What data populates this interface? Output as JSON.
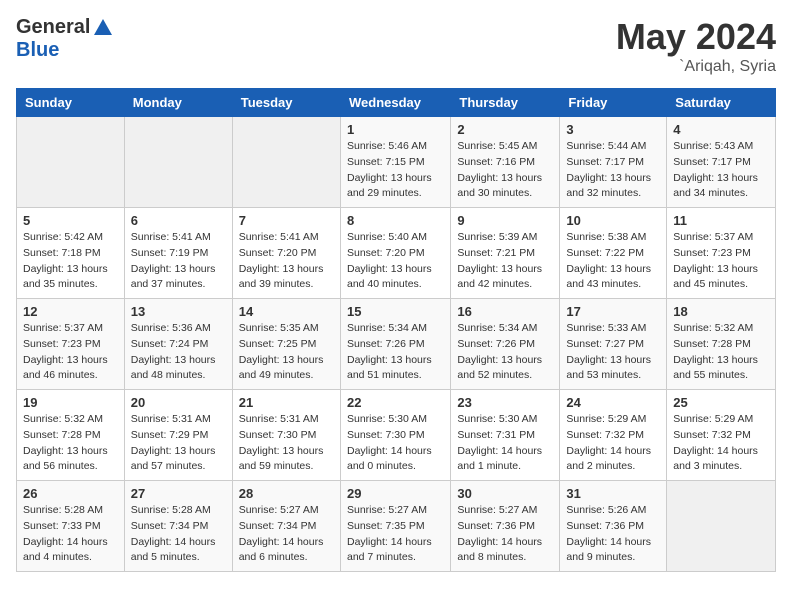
{
  "logo": {
    "general": "General",
    "blue": "Blue"
  },
  "title": "May 2024",
  "location": "`Ariqah, Syria",
  "days_of_week": [
    "Sunday",
    "Monday",
    "Tuesday",
    "Wednesday",
    "Thursday",
    "Friday",
    "Saturday"
  ],
  "weeks": [
    [
      {
        "day": "",
        "info": ""
      },
      {
        "day": "",
        "info": ""
      },
      {
        "day": "",
        "info": ""
      },
      {
        "day": "1",
        "info": "Sunrise: 5:46 AM\nSunset: 7:15 PM\nDaylight: 13 hours\nand 29 minutes."
      },
      {
        "day": "2",
        "info": "Sunrise: 5:45 AM\nSunset: 7:16 PM\nDaylight: 13 hours\nand 30 minutes."
      },
      {
        "day": "3",
        "info": "Sunrise: 5:44 AM\nSunset: 7:17 PM\nDaylight: 13 hours\nand 32 minutes."
      },
      {
        "day": "4",
        "info": "Sunrise: 5:43 AM\nSunset: 7:17 PM\nDaylight: 13 hours\nand 34 minutes."
      }
    ],
    [
      {
        "day": "5",
        "info": "Sunrise: 5:42 AM\nSunset: 7:18 PM\nDaylight: 13 hours\nand 35 minutes."
      },
      {
        "day": "6",
        "info": "Sunrise: 5:41 AM\nSunset: 7:19 PM\nDaylight: 13 hours\nand 37 minutes."
      },
      {
        "day": "7",
        "info": "Sunrise: 5:41 AM\nSunset: 7:20 PM\nDaylight: 13 hours\nand 39 minutes."
      },
      {
        "day": "8",
        "info": "Sunrise: 5:40 AM\nSunset: 7:20 PM\nDaylight: 13 hours\nand 40 minutes."
      },
      {
        "day": "9",
        "info": "Sunrise: 5:39 AM\nSunset: 7:21 PM\nDaylight: 13 hours\nand 42 minutes."
      },
      {
        "day": "10",
        "info": "Sunrise: 5:38 AM\nSunset: 7:22 PM\nDaylight: 13 hours\nand 43 minutes."
      },
      {
        "day": "11",
        "info": "Sunrise: 5:37 AM\nSunset: 7:23 PM\nDaylight: 13 hours\nand 45 minutes."
      }
    ],
    [
      {
        "day": "12",
        "info": "Sunrise: 5:37 AM\nSunset: 7:23 PM\nDaylight: 13 hours\nand 46 minutes."
      },
      {
        "day": "13",
        "info": "Sunrise: 5:36 AM\nSunset: 7:24 PM\nDaylight: 13 hours\nand 48 minutes."
      },
      {
        "day": "14",
        "info": "Sunrise: 5:35 AM\nSunset: 7:25 PM\nDaylight: 13 hours\nand 49 minutes."
      },
      {
        "day": "15",
        "info": "Sunrise: 5:34 AM\nSunset: 7:26 PM\nDaylight: 13 hours\nand 51 minutes."
      },
      {
        "day": "16",
        "info": "Sunrise: 5:34 AM\nSunset: 7:26 PM\nDaylight: 13 hours\nand 52 minutes."
      },
      {
        "day": "17",
        "info": "Sunrise: 5:33 AM\nSunset: 7:27 PM\nDaylight: 13 hours\nand 53 minutes."
      },
      {
        "day": "18",
        "info": "Sunrise: 5:32 AM\nSunset: 7:28 PM\nDaylight: 13 hours\nand 55 minutes."
      }
    ],
    [
      {
        "day": "19",
        "info": "Sunrise: 5:32 AM\nSunset: 7:28 PM\nDaylight: 13 hours\nand 56 minutes."
      },
      {
        "day": "20",
        "info": "Sunrise: 5:31 AM\nSunset: 7:29 PM\nDaylight: 13 hours\nand 57 minutes."
      },
      {
        "day": "21",
        "info": "Sunrise: 5:31 AM\nSunset: 7:30 PM\nDaylight: 13 hours\nand 59 minutes."
      },
      {
        "day": "22",
        "info": "Sunrise: 5:30 AM\nSunset: 7:30 PM\nDaylight: 14 hours\nand 0 minutes."
      },
      {
        "day": "23",
        "info": "Sunrise: 5:30 AM\nSunset: 7:31 PM\nDaylight: 14 hours\nand 1 minute."
      },
      {
        "day": "24",
        "info": "Sunrise: 5:29 AM\nSunset: 7:32 PM\nDaylight: 14 hours\nand 2 minutes."
      },
      {
        "day": "25",
        "info": "Sunrise: 5:29 AM\nSunset: 7:32 PM\nDaylight: 14 hours\nand 3 minutes."
      }
    ],
    [
      {
        "day": "26",
        "info": "Sunrise: 5:28 AM\nSunset: 7:33 PM\nDaylight: 14 hours\nand 4 minutes."
      },
      {
        "day": "27",
        "info": "Sunrise: 5:28 AM\nSunset: 7:34 PM\nDaylight: 14 hours\nand 5 minutes."
      },
      {
        "day": "28",
        "info": "Sunrise: 5:27 AM\nSunset: 7:34 PM\nDaylight: 14 hours\nand 6 minutes."
      },
      {
        "day": "29",
        "info": "Sunrise: 5:27 AM\nSunset: 7:35 PM\nDaylight: 14 hours\nand 7 minutes."
      },
      {
        "day": "30",
        "info": "Sunrise: 5:27 AM\nSunset: 7:36 PM\nDaylight: 14 hours\nand 8 minutes."
      },
      {
        "day": "31",
        "info": "Sunrise: 5:26 AM\nSunset: 7:36 PM\nDaylight: 14 hours\nand 9 minutes."
      },
      {
        "day": "",
        "info": ""
      }
    ]
  ]
}
